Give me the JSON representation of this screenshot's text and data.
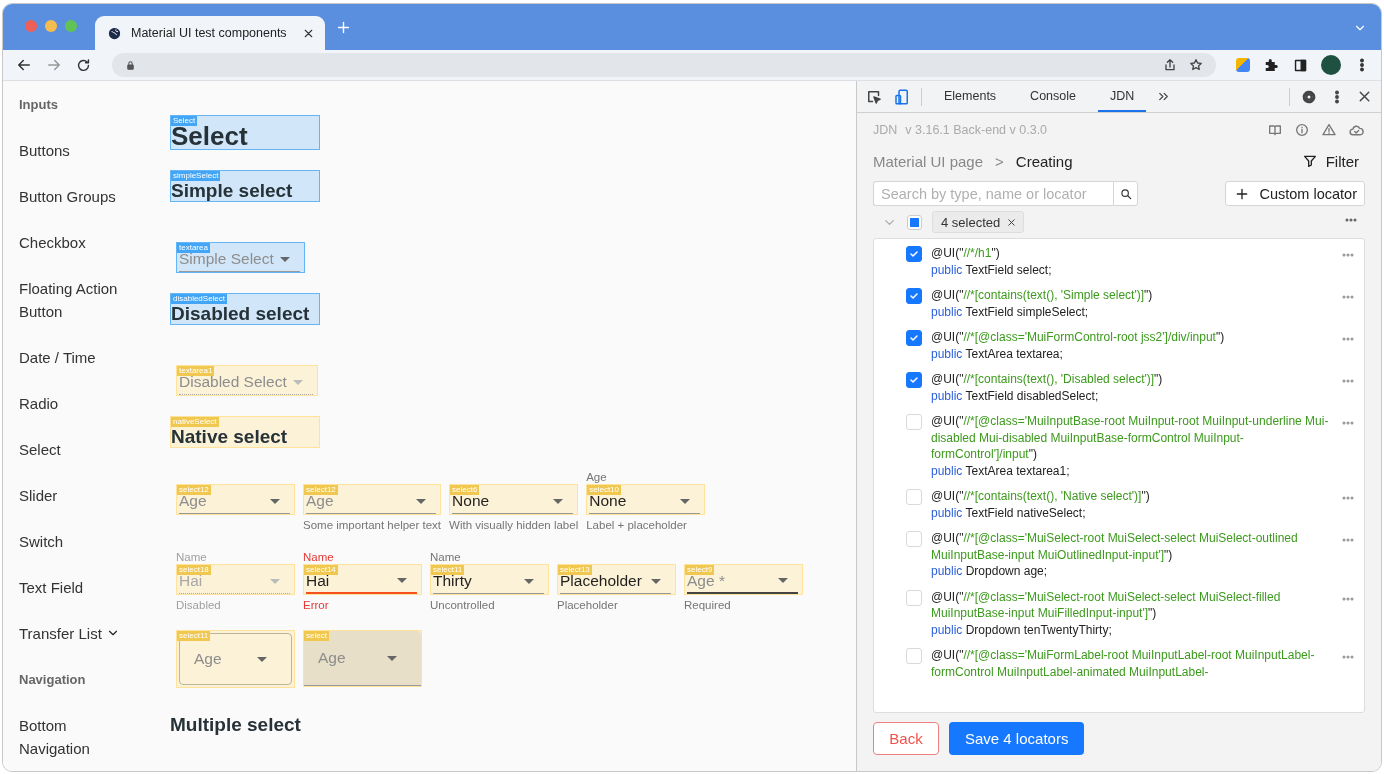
{
  "browser": {
    "tab": {
      "title": "Material UI test components"
    }
  },
  "nav": {
    "items": [
      {
        "kind": "heading",
        "label": "Inputs"
      },
      {
        "kind": "link",
        "label": "Buttons"
      },
      {
        "kind": "link",
        "label": "Button Groups"
      },
      {
        "kind": "link",
        "label": "Checkbox"
      },
      {
        "kind": "link",
        "label": "Floating Action Button"
      },
      {
        "kind": "link",
        "label": "Date / Time"
      },
      {
        "kind": "link",
        "label": "Radio"
      },
      {
        "kind": "link",
        "label": "Select"
      },
      {
        "kind": "link",
        "label": "Slider"
      },
      {
        "kind": "link",
        "label": "Switch"
      },
      {
        "kind": "link",
        "label": "Text Field"
      },
      {
        "kind": "group",
        "label": "Transfer List"
      },
      {
        "kind": "heading",
        "label": "Navigation"
      },
      {
        "kind": "link",
        "label": "Bottom Navigation"
      }
    ]
  },
  "demo": {
    "rows": [
      {
        "items": [
          {
            "kind": "h1",
            "tag": "Select",
            "selected": true,
            "text": "Select"
          }
        ]
      },
      {
        "items": [
          {
            "kind": "h2",
            "tag": "simpleSelect",
            "selected": true,
            "text": "Simple select"
          }
        ]
      },
      {
        "items": [
          {
            "kind": "select",
            "tag": "textarea",
            "selected": true,
            "placeholder": "Simple Select",
            "disabled": false,
            "error": false,
            "focused": false
          }
        ]
      },
      {
        "items": [
          {
            "kind": "h2",
            "tag": "disabledSelect",
            "selected": true,
            "text": "Disabled select"
          }
        ]
      },
      {
        "items": [
          {
            "kind": "select",
            "tag": "textarea1",
            "selected": false,
            "placeholder": "Disabled Select",
            "disabled": true,
            "error": false,
            "focused": false
          }
        ]
      },
      {
        "items": [
          {
            "kind": "h2",
            "tag": "nativeSelect",
            "selected": false,
            "text": "Native select"
          }
        ]
      },
      {
        "items": [
          {
            "kind": "select",
            "tag": "select12",
            "selected": false,
            "placeholder": "Age",
            "disabled": false,
            "error": false,
            "focused": false
          },
          {
            "kind": "select",
            "tag": "select12",
            "selected": false,
            "placeholder": "Age",
            "helper": "Some important helper text",
            "disabled": false,
            "error": false,
            "focused": false
          },
          {
            "kind": "select",
            "tag": "select6",
            "selected": false,
            "value": "None",
            "helper": "With visually hidden label",
            "disabled": false,
            "error": false,
            "focused": false
          },
          {
            "kind": "select",
            "tag": "select10",
            "selected": false,
            "label": "Age",
            "value": "None",
            "helper": "Label + placeholder",
            "disabled": false,
            "error": false,
            "focused": false
          }
        ]
      },
      {
        "items": [
          {
            "kind": "select",
            "tag": "select18",
            "selected": false,
            "label": "Name",
            "value": "Hai",
            "helper": "Disabled",
            "disabled": true,
            "error": false,
            "focused": false
          },
          {
            "kind": "select",
            "tag": "select14",
            "selected": false,
            "label": "Name",
            "value": "Hai",
            "helper": "Error",
            "disabled": false,
            "error": true,
            "focused": false
          },
          {
            "kind": "select",
            "tag": "select11",
            "selected": false,
            "label": "Name",
            "value": "Thirty",
            "helper": "Uncontrolled",
            "disabled": false,
            "error": false,
            "focused": false
          },
          {
            "kind": "select",
            "tag": "select13",
            "selected": false,
            "value": "Placeholder",
            "helper": "Placeholder",
            "disabled": false,
            "error": false,
            "focused": false
          },
          {
            "kind": "select",
            "tag": "select9",
            "selected": false,
            "placeholder": "Age *",
            "helper": "Required",
            "disabled": false,
            "error": false,
            "focused": true
          }
        ]
      },
      {
        "items": [
          {
            "kind": "outlined",
            "tag": "select11",
            "selected": false,
            "placeholder": "Age",
            "disabled": false,
            "error": false,
            "focused": false
          },
          {
            "kind": "filled",
            "tag": "select",
            "selected": false,
            "placeholder": "Age",
            "disabled": false,
            "error": false,
            "focused": false
          }
        ]
      },
      {
        "items": [
          {
            "kind": "h2",
            "text": "Multiple select"
          }
        ]
      }
    ]
  },
  "devtools": {
    "device_mode": true,
    "tabs": [
      {
        "label": "Elements",
        "selected": false
      },
      {
        "label": "Console",
        "selected": false
      },
      {
        "label": "JDN",
        "selected": true
      }
    ]
  },
  "jdn": {
    "name": "JDN",
    "version": "v 3.16.1 Back-end v 0.3.0",
    "breadcrumb": [
      "Material UI page",
      ">",
      "Creating"
    ],
    "filter": "Filter",
    "search": {
      "placeholder": "Search by type, name or locator"
    },
    "custom_locator": "Custom locator",
    "selection": {
      "indeterminate": true,
      "label": "4 selected"
    },
    "locators": [
      {
        "checked": true,
        "prefix": "@UI(\"",
        "locator": "//*/h1",
        "suffix": "\")",
        "modifier": "public",
        "declaration": "TextField select;"
      },
      {
        "checked": true,
        "prefix": "@UI(\"",
        "locator": "//*[contains(text(), 'Simple select')]",
        "suffix": "\")",
        "modifier": "public",
        "declaration": "TextField simpleSelect;"
      },
      {
        "checked": true,
        "prefix": "@UI(\"",
        "locator": "//*[@class='MuiFormControl-root jss2']/div/input",
        "suffix": "\")",
        "modifier": "public",
        "declaration": "TextArea textarea;"
      },
      {
        "checked": true,
        "prefix": "@UI(\"",
        "locator": "//*[contains(text(), 'Disabled select')]",
        "suffix": "\")",
        "modifier": "public",
        "declaration": "TextField disabledSelect;"
      },
      {
        "checked": false,
        "prefix": "@UI(\"",
        "locator": "//*[@class='MuiInputBase-root MuiInput-root MuiInput-underline Mui-disabled Mui-disabled MuiInputBase-formControl MuiInput-formControl']/input",
        "suffix": "\")",
        "modifier": "public",
        "declaration": "TextArea textarea1;"
      },
      {
        "checked": false,
        "prefix": "@UI(\"",
        "locator": "//*[contains(text(), 'Native select')]",
        "suffix": "\")",
        "modifier": "public",
        "declaration": "TextField nativeSelect;"
      },
      {
        "checked": false,
        "prefix": "@UI(\"",
        "locator": "//*[@class='MuiSelect-root MuiSelect-select MuiSelect-outlined MuiInputBase-input MuiOutlinedInput-input']",
        "suffix": "\")",
        "modifier": "public",
        "declaration": "Dropdown age;"
      },
      {
        "checked": false,
        "prefix": "@UI(\"",
        "locator": "//*[@class='MuiSelect-root MuiSelect-select MuiSelect-filled MuiInputBase-input MuiFilledInput-input']",
        "suffix": "\")",
        "modifier": "public",
        "declaration": "Dropdown tenTwentyThirty;"
      },
      {
        "checked": false,
        "prefix": "@UI(\"",
        "locator": "//*[@class='MuiFormLabel-root MuiInputLabel-root MuiInputLabel-formControl MuiInputLabel-animated MuiInputLabel-"
      }
    ],
    "back": "Back",
    "save": "Save 4 locators"
  }
}
